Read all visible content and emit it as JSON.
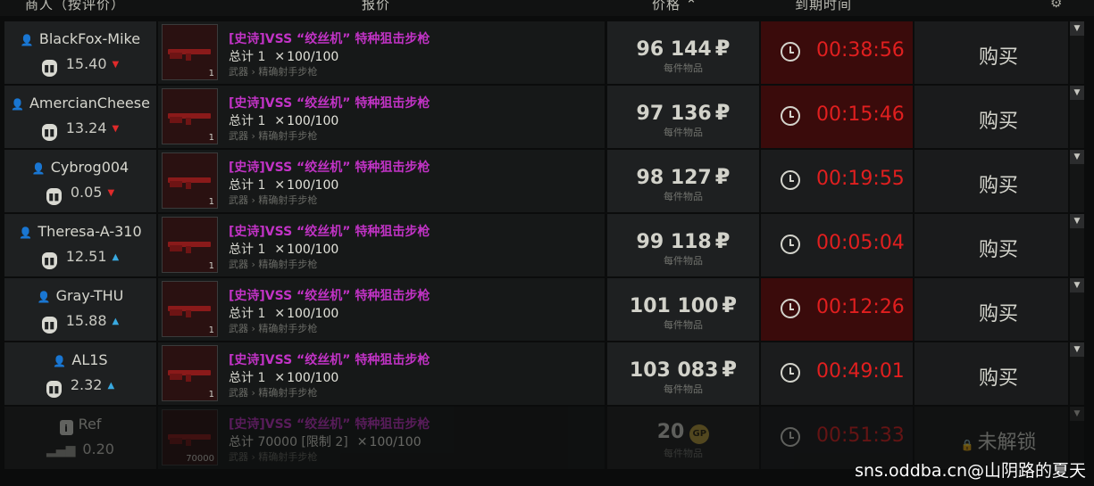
{
  "header": {
    "col_seller": "商人（按评价）",
    "col_offer": "报价",
    "col_price": "价格",
    "col_expiry": "到期时间",
    "sort_icon": "sort-up-arrow",
    "settings_icon": "gear-icon"
  },
  "rows": [
    {
      "seller": "BlackFox-Mike",
      "rating": "15.40",
      "trend": "down",
      "item": "[史诗]VSS “绞丝机” 特种狙击步枪",
      "qty_label": "总计 1",
      "durability": "100/100",
      "category": "武器 › 精确射手步枪",
      "thumb_count": "1",
      "price": "96 144",
      "currency": "₽",
      "per_unit": "每件物品",
      "timer": "00:38:56",
      "action": "购买"
    },
    {
      "seller": "AmercianCheese",
      "rating": "13.24",
      "trend": "down",
      "item": "[史诗]VSS “绞丝机” 特种狙击步枪",
      "qty_label": "总计 1",
      "durability": "100/100",
      "category": "武器 › 精确射手步枪",
      "thumb_count": "1",
      "price": "97 136",
      "currency": "₽",
      "per_unit": "每件物品",
      "timer": "00:15:46",
      "action": "购买"
    },
    {
      "seller": "Cybrog004",
      "rating": "0.05",
      "trend": "down",
      "item": "[史诗]VSS “绞丝机” 特种狙击步枪",
      "qty_label": "总计 1",
      "durability": "100/100",
      "category": "武器 › 精确射手步枪",
      "thumb_count": "1",
      "price": "98 127",
      "currency": "₽",
      "per_unit": "每件物品",
      "timer": "00:19:55",
      "action": "购买"
    },
    {
      "seller": "Theresa-A-310",
      "rating": "12.51",
      "trend": "up",
      "item": "[史诗]VSS “绞丝机” 特种狙击步枪",
      "qty_label": "总计 1",
      "durability": "100/100",
      "category": "武器 › 精确射手步枪",
      "thumb_count": "1",
      "price": "99 118",
      "currency": "₽",
      "per_unit": "每件物品",
      "timer": "00:05:04",
      "action": "购买"
    },
    {
      "seller": "Gray-THU",
      "rating": "15.88",
      "trend": "up",
      "item": "[史诗]VSS “绞丝机” 特种狙击步枪",
      "qty_label": "总计 1",
      "durability": "100/100",
      "category": "武器 › 精确射手步枪",
      "thumb_count": "1",
      "price": "101 100",
      "currency": "₽",
      "per_unit": "每件物品",
      "timer": "00:12:26",
      "action": "购买"
    },
    {
      "seller": "AL1S",
      "rating": "2.32",
      "trend": "up",
      "item": "[史诗]VSS “绞丝机” 特种狙击步枪",
      "qty_label": "总计 1",
      "durability": "100/100",
      "category": "武器 › 精确射手步枪",
      "thumb_count": "1",
      "price": "103 083",
      "currency": "₽",
      "per_unit": "每件物品",
      "timer": "00:49:01",
      "action": "购买"
    }
  ],
  "ref_row": {
    "seller": "Ref",
    "rating": "0.20",
    "item": "[史诗]VSS “绞丝机” 特种狙击步枪",
    "qty_label": "总计 70000 [限制 2]",
    "durability": "100/100",
    "category": "武器 › 精确射手步枪",
    "thumb_count": "70000",
    "price": "20",
    "currency_badge": "GP",
    "per_unit": "每件物品",
    "timer": "00:51:33",
    "action": "未解锁"
  },
  "colors": {
    "timer_red": "#e01f1f",
    "epic_purple": "#c233c6",
    "trend_down": "#e02a2a",
    "trend_up": "#39a9e0"
  },
  "watermark": "sns.oddba.cn@山阴路的夏天"
}
